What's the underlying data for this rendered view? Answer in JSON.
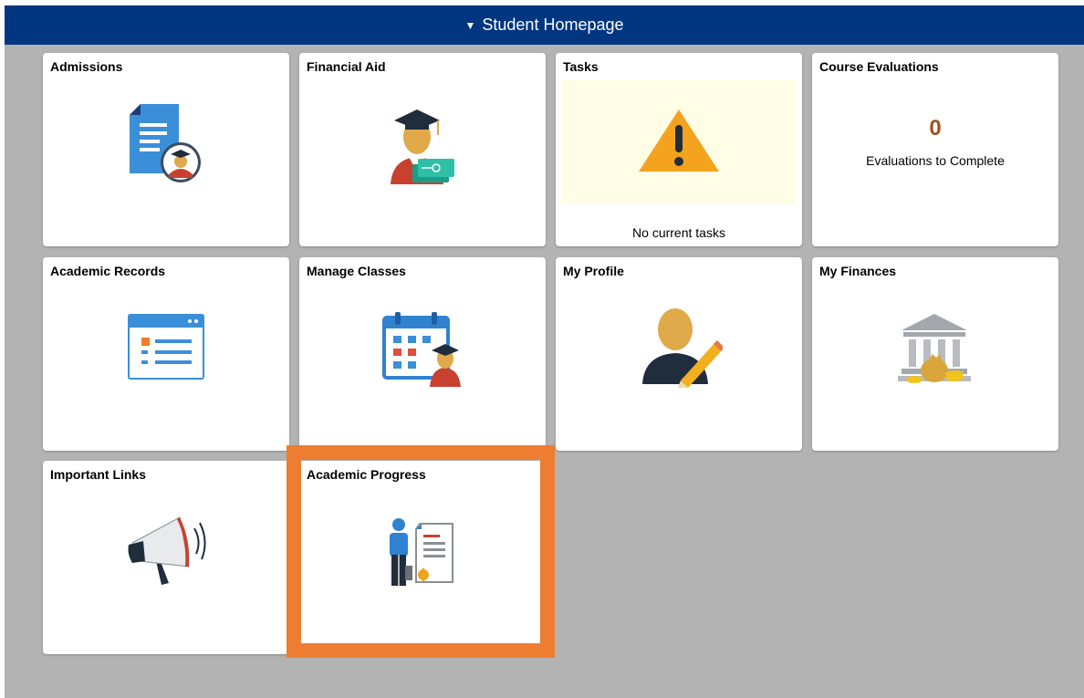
{
  "header": {
    "caret": "▼",
    "title": "Student Homepage"
  },
  "tiles": {
    "admissions": {
      "title": "Admissions",
      "icon": "admissions-document-icon"
    },
    "financial_aid": {
      "title": "Financial Aid",
      "icon": "graduate-money-icon"
    },
    "tasks": {
      "title": "Tasks",
      "icon": "warning-icon",
      "note": "No current tasks"
    },
    "course_evaluations": {
      "title": "Course Evaluations",
      "count": "0",
      "label": "Evaluations to Complete"
    },
    "academic_records": {
      "title": "Academic Records",
      "icon": "records-window-icon"
    },
    "manage_classes": {
      "title": "Manage Classes",
      "icon": "calendar-student-icon"
    },
    "my_profile": {
      "title": "My Profile",
      "icon": "profile-edit-icon"
    },
    "my_finances": {
      "title": "My Finances",
      "icon": "bank-money-icon"
    },
    "important_links": {
      "title": "Important Links",
      "icon": "megaphone-icon"
    },
    "academic_progress": {
      "title": "Academic Progress",
      "icon": "person-certificate-icon"
    }
  },
  "colors": {
    "header": "#003580",
    "background": "#b3b3b3",
    "highlight": "#ed7d31",
    "count": "#a3521b"
  }
}
